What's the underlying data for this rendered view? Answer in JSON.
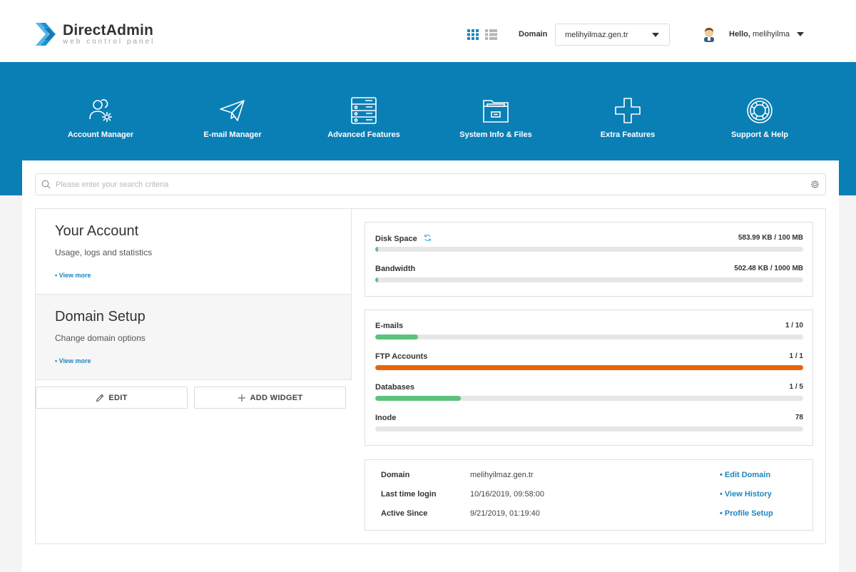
{
  "header": {
    "logo_name": "DirectAdmin",
    "logo_tagline": "web control panel",
    "domain_label": "Domain",
    "domain_value": "melihyilmaz.gen.tr",
    "hello_prefix": "Hello,",
    "username": "melihyilma"
  },
  "nav": [
    {
      "label": "Account Manager",
      "icon": "users-gear-icon"
    },
    {
      "label": "E-mail Manager",
      "icon": "paper-plane-icon"
    },
    {
      "label": "Advanced Features",
      "icon": "server-icon"
    },
    {
      "label": "System Info & Files",
      "icon": "folder-icon"
    },
    {
      "label": "Extra Features",
      "icon": "plus-icon"
    },
    {
      "label": "Support & Help",
      "icon": "lifebuoy-icon"
    }
  ],
  "search": {
    "placeholder": "Please enter your search criteria"
  },
  "cards": [
    {
      "title": "Your Account",
      "subtitle": "Usage, logs and statistics",
      "more": "• View more"
    },
    {
      "title": "Domain Setup",
      "subtitle": "Change domain options",
      "more": "• View more"
    }
  ],
  "buttons": {
    "edit": "EDIT",
    "add_widget": "ADD WIDGET"
  },
  "usage": [
    {
      "name": "Disk Space",
      "value": "583.99 KB / 100 MB",
      "fraction": 0.006,
      "color": "#5cc27c"
    },
    {
      "name": "Bandwidth",
      "value": "502.48 KB / 1000 MB",
      "fraction": 0.0005,
      "color": "#5cc27c"
    }
  ],
  "counts": [
    {
      "name": "E-mails",
      "value": "1 / 10",
      "fraction": 0.1,
      "color": "#5cc27c"
    },
    {
      "name": "FTP Accounts",
      "value": "1 / 1",
      "fraction": 1.0,
      "color": "#e8650c"
    },
    {
      "name": "Databases",
      "value": "1 / 5",
      "fraction": 0.2,
      "color": "#5cc27c"
    },
    {
      "name": "Inode",
      "value": "78",
      "fraction": 0,
      "color": "#5cc27c"
    }
  ],
  "info": [
    {
      "key": "Domain",
      "value": "melihyilmaz.gen.tr",
      "link": "• Edit Domain"
    },
    {
      "key": "Last time login",
      "value": "10/16/2019, 09:58:00",
      "link": "• View History"
    },
    {
      "key": "Active Since",
      "value": "9/21/2019, 01:19:40",
      "link": "• Profile Setup"
    }
  ],
  "colors": {
    "brand_blue": "#0a7fb5",
    "link": "#1b86c2",
    "ok": "#5cc27c",
    "full": "#e8650c"
  }
}
